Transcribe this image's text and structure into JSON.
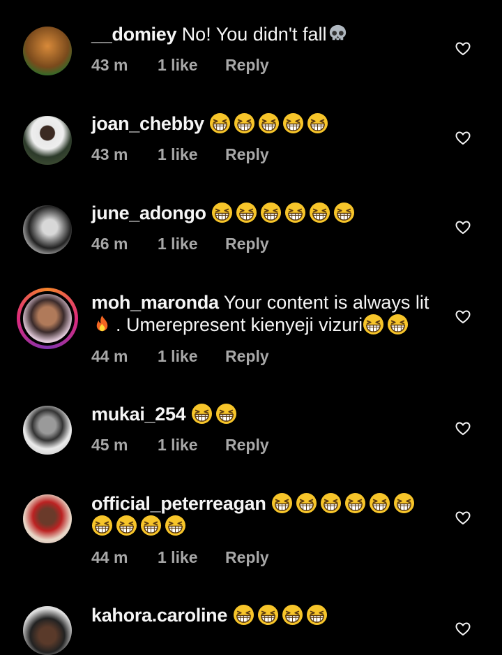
{
  "comments": [
    {
      "username": "__domiey",
      "text": "No! You didn't fall",
      "emoji": "skull",
      "emoji_count": 1,
      "time": "43 m",
      "likes": "1 like",
      "reply": "Reply"
    },
    {
      "username": "joan_chebby",
      "text": "",
      "emoji": "laugh",
      "emoji_count": 5,
      "time": "43 m",
      "likes": "1 like",
      "reply": "Reply"
    },
    {
      "username": "june_adongo",
      "text": "",
      "emoji": "laugh",
      "emoji_count": 6,
      "time": "46 m",
      "likes": "1 like",
      "reply": "Reply"
    },
    {
      "username": "moh_maronda",
      "text": "Your content is always lit",
      "text2": ". Umerepresent kienyeji vizuri",
      "emoji": "laugh",
      "emoji_count": 2,
      "time": "44 m",
      "likes": "1 like",
      "reply": "Reply",
      "story_ring": true
    },
    {
      "username": "mukai_254",
      "text": "",
      "emoji": "laugh",
      "emoji_count": 2,
      "time": "45 m",
      "likes": "1 like",
      "reply": "Reply"
    },
    {
      "username": "official_peterreagan",
      "text": "",
      "emoji": "laugh",
      "emoji_count": 10,
      "time": "44 m",
      "likes": "1 like",
      "reply": "Reply"
    },
    {
      "username": "kahora.caroline",
      "text": "",
      "emoji": "laugh",
      "emoji_count": 4
    }
  ],
  "icons": {
    "like": "heart-outline-icon",
    "skull": "skull-emoji",
    "laugh": "grinning-squinting-emoji",
    "fire": "fire-emoji"
  },
  "colors": {
    "background": "#000000",
    "text": "#f5f5f5",
    "meta": "#a8a8a8",
    "emoji": "#f7c52a"
  }
}
